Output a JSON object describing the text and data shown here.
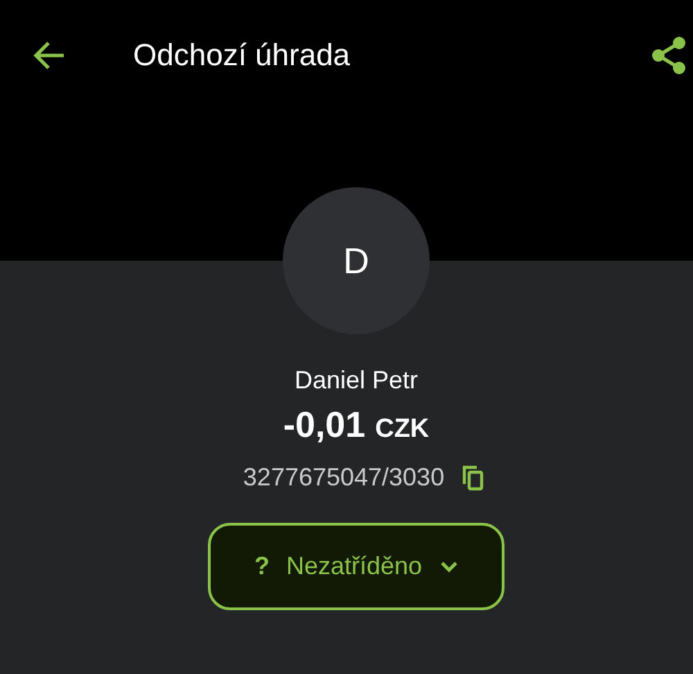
{
  "top_bar": {
    "title": "Odchozí úhrada"
  },
  "counterparty": {
    "initial": "D",
    "name": "Daniel Petr",
    "amount": "-0,01",
    "currency": "CZK",
    "account": "3277675047/3030"
  },
  "category_button": {
    "icon_text": "?",
    "label": "Nezatříděno"
  }
}
